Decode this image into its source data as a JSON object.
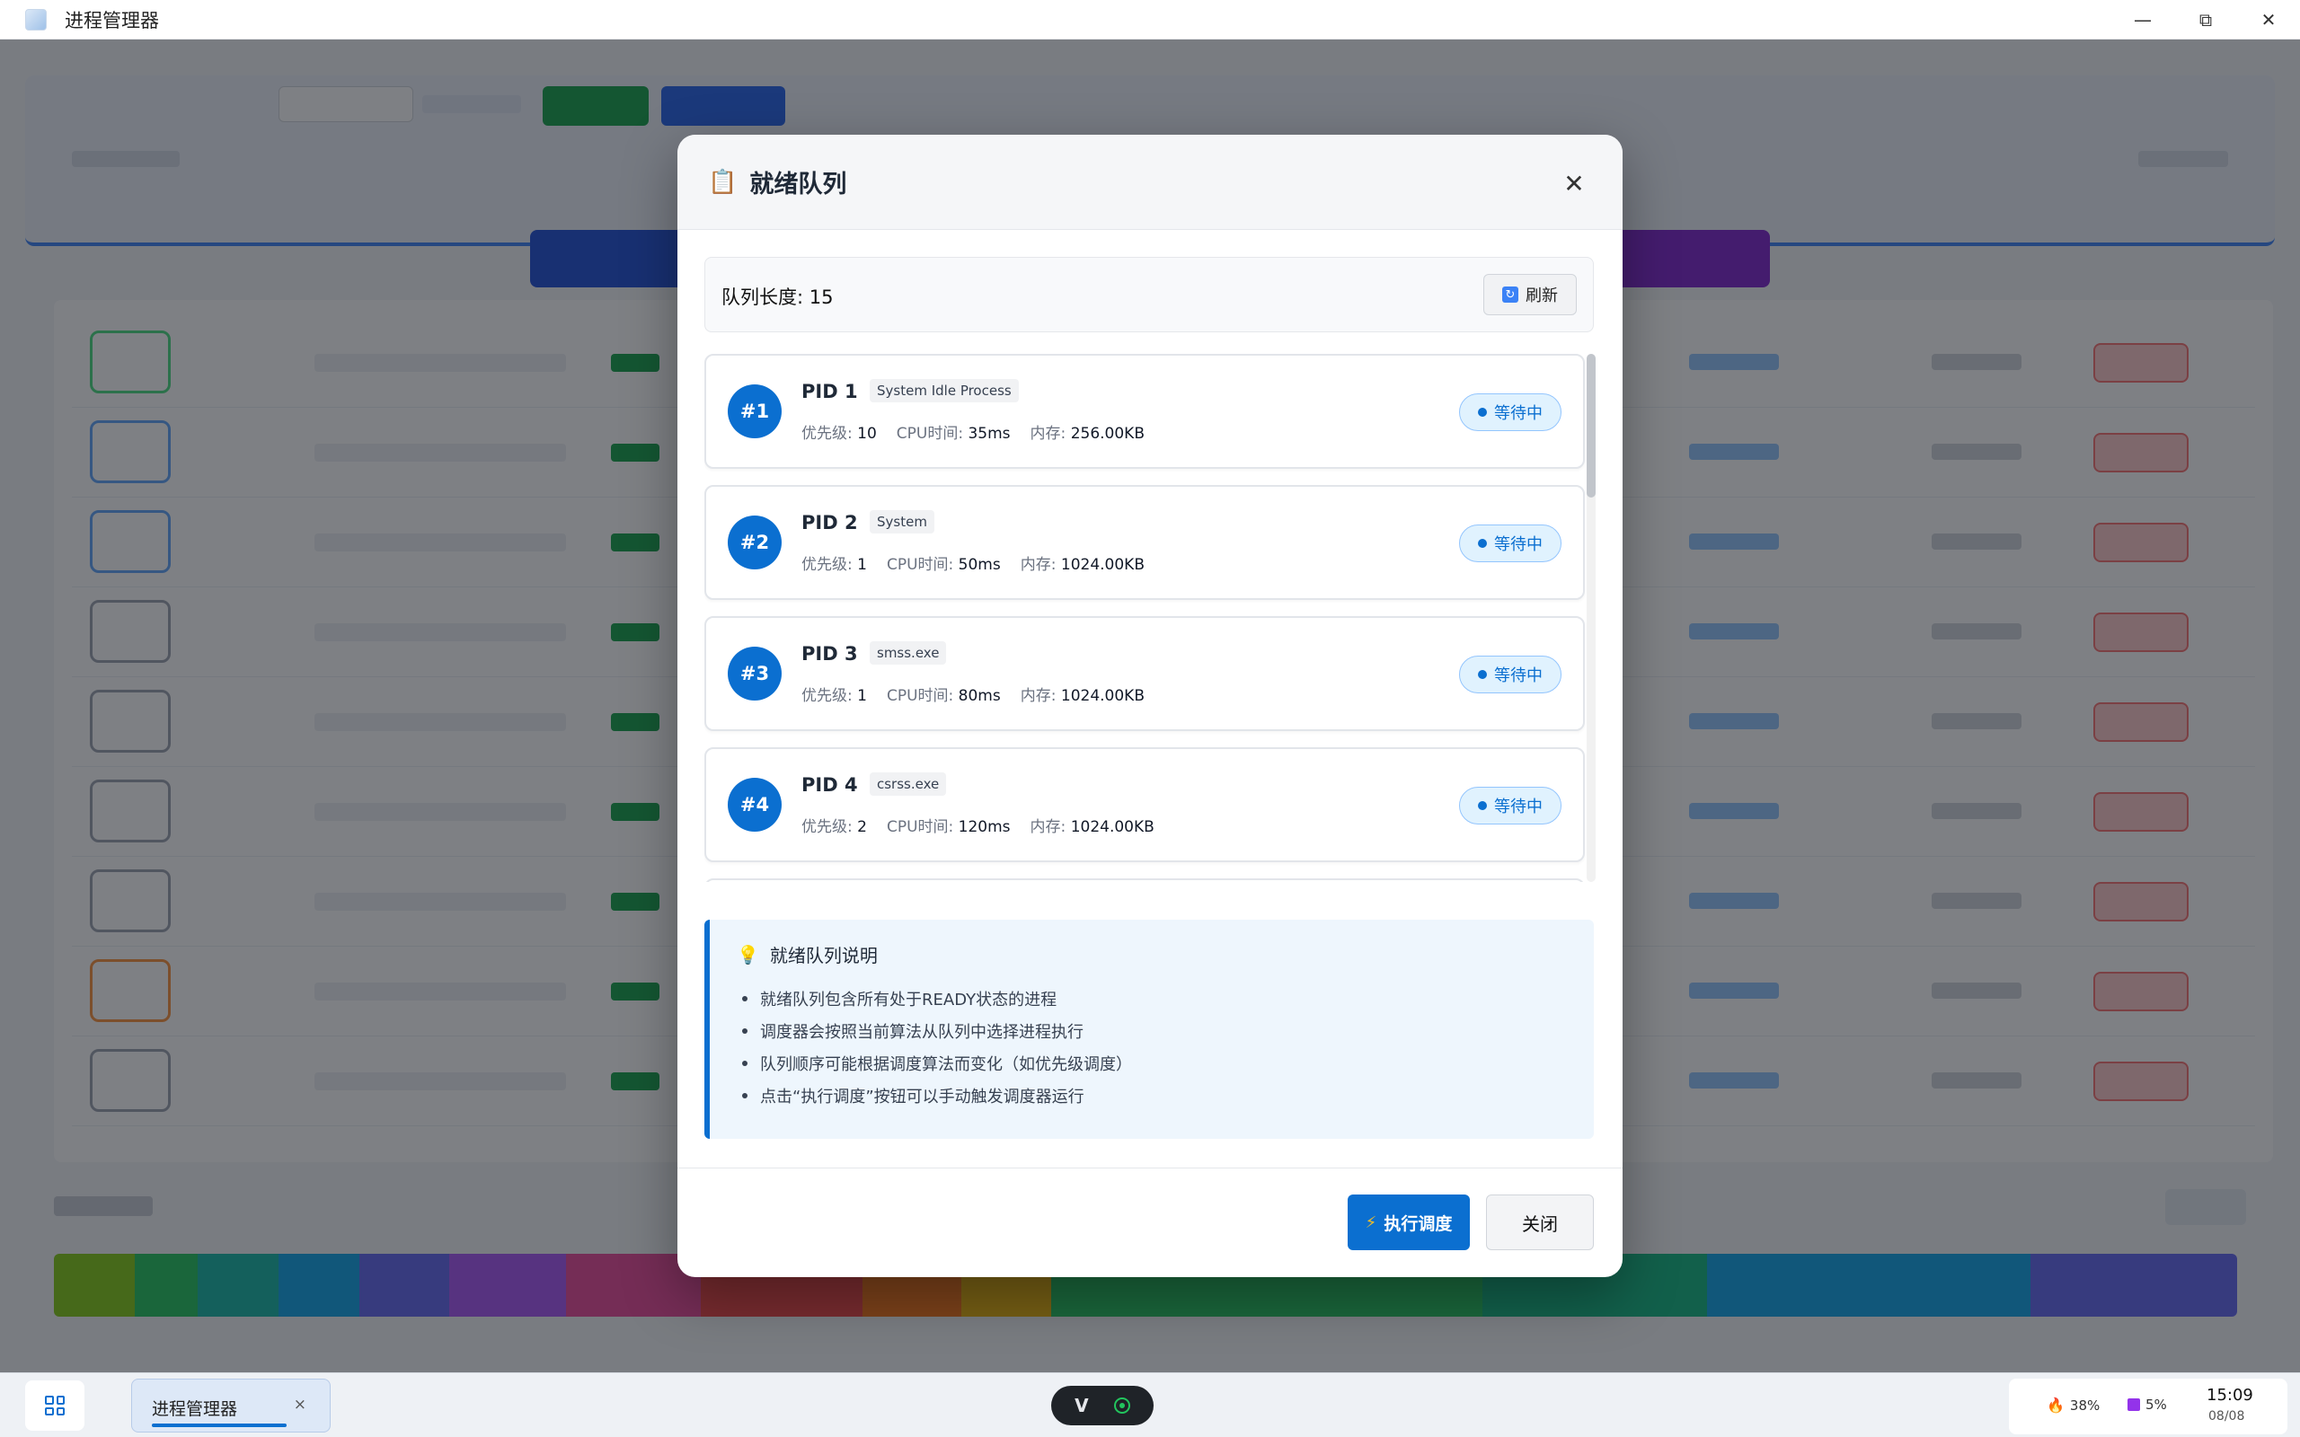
{
  "window": {
    "title": "进程管理器",
    "controls": {
      "minimize": "—",
      "restore": "⧉",
      "close": "✕"
    }
  },
  "modal": {
    "icon": "clipboard-icon",
    "title": "就绪队列",
    "close_symbol": "✕",
    "queue_length_label": "队列长度: 15",
    "refresh_label": "刷新",
    "processes": [
      {
        "index": "#1",
        "pid": "PID 1",
        "name": "System Idle Process",
        "priority_label": "优先级:",
        "priority": "10",
        "cpu_label": "CPU时间:",
        "cpu": "35ms",
        "mem_label": "内存:",
        "mem": "256.00KB",
        "status": "等待中"
      },
      {
        "index": "#2",
        "pid": "PID 2",
        "name": "System",
        "priority_label": "优先级:",
        "priority": "1",
        "cpu_label": "CPU时间:",
        "cpu": "50ms",
        "mem_label": "内存:",
        "mem": "1024.00KB",
        "status": "等待中"
      },
      {
        "index": "#3",
        "pid": "PID 3",
        "name": "smss.exe",
        "priority_label": "优先级:",
        "priority": "1",
        "cpu_label": "CPU时间:",
        "cpu": "80ms",
        "mem_label": "内存:",
        "mem": "1024.00KB",
        "status": "等待中"
      },
      {
        "index": "#4",
        "pid": "PID 4",
        "name": "csrss.exe",
        "priority_label": "优先级:",
        "priority": "2",
        "cpu_label": "CPU时间:",
        "cpu": "120ms",
        "mem_label": "内存:",
        "mem": "1024.00KB",
        "status": "等待中"
      }
    ],
    "info": {
      "icon": "lightbulb-icon",
      "title": "就绪队列说明",
      "items": [
        "就绪队列包含所有处于READY状态的进程",
        "调度器会按照当前算法从队列中选择进程执行",
        "队列顺序可能根据调度算法而变化（如优先级调度）",
        "点击“执行调度”按钮可以手动触发调度器运行"
      ]
    },
    "execute_label": "执行调度",
    "close_label": "关闭"
  },
  "taskbar": {
    "app_label": "进程管理器",
    "app_close": "×",
    "cpu_usage": "38%",
    "disk_usage": "5%",
    "time": "15:09",
    "date": "08/08"
  },
  "colors": {
    "accent": "#0b6fd0",
    "status_bg": "#e0f2fe",
    "info_bg": "#eef6fd"
  }
}
